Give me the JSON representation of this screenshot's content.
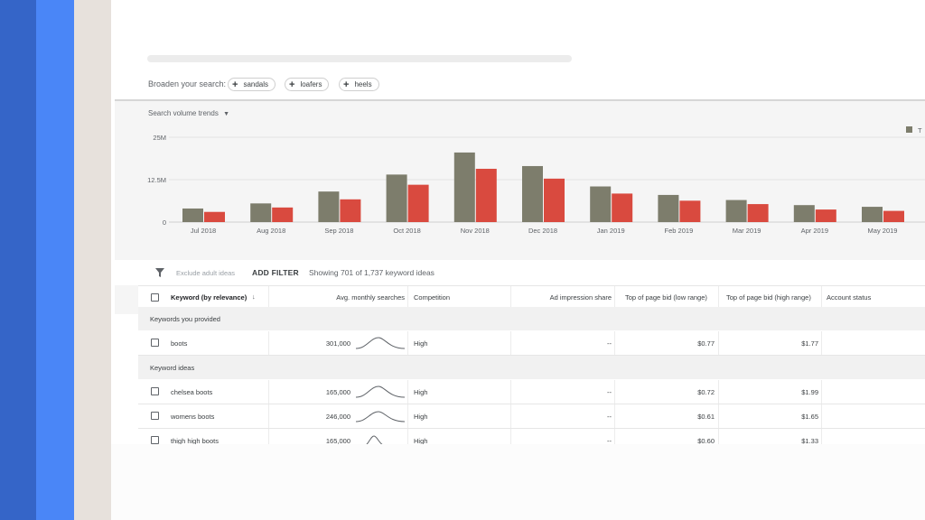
{
  "colors": {
    "stripe_dark": "#3565c8",
    "stripe_blue": "#4a86f7",
    "stripe_beige": "#e7e1dc",
    "bar_grey": "#7d7d6c",
    "bar_red": "#d94a3f"
  },
  "broaden": {
    "label": "Broaden your search:",
    "chips": [
      {
        "icon": "plus-icon",
        "label": "sandals"
      },
      {
        "icon": "plus-icon",
        "label": "loafers"
      },
      {
        "icon": "plus-icon",
        "label": "heels"
      }
    ]
  },
  "chart": {
    "dropdown_label": "Search volume trends",
    "legend_label": "T",
    "y_ticks": [
      "25M",
      "12.5M",
      "0"
    ]
  },
  "chart_data": {
    "type": "bar",
    "categories": [
      "Jul 2018",
      "Aug 2018",
      "Sep 2018",
      "Oct 2018",
      "Nov 2018",
      "Dec 2018",
      "Jan 2019",
      "Feb 2019",
      "Mar 2019",
      "Apr 2019",
      "May 2019"
    ],
    "series": [
      {
        "name": "T",
        "color": "#7d7d6c",
        "values": [
          4,
          5.5,
          9,
          14,
          20.5,
          16.5,
          10.5,
          8,
          6.5,
          5,
          4.5
        ]
      },
      {
        "color": "#d94a3f",
        "values": [
          3,
          4.3,
          6.7,
          11,
          15.7,
          12.8,
          8.4,
          6.3,
          5.3,
          3.7,
          3.3
        ]
      }
    ],
    "ylim": [
      0,
      25
    ],
    "ylabel": "",
    "xlabel": "",
    "grid": true,
    "legend": "top-right"
  },
  "filter": {
    "exclude_label": "Exclude adult ideas",
    "add_filter_label": "ADD FILTER",
    "showing_text": "Showing 701 of 1,737 keyword ideas"
  },
  "table": {
    "headers": [
      "Keyword (by relevance)",
      "Avg. monthly searches",
      "Competition",
      "Ad impression share",
      "Top of page bid (low range)",
      "Top of page bid (high range)",
      "Account status"
    ],
    "sections": [
      {
        "title": "Keywords you provided",
        "rows": [
          {
            "keyword": "boots",
            "searches": "301,000",
            "competition": "High",
            "share": "--",
            "low": "$0.77",
            "high": "$1.77",
            "status": ""
          }
        ]
      },
      {
        "title": "Keyword ideas",
        "rows": [
          {
            "keyword": "chelsea boots",
            "searches": "165,000",
            "competition": "High",
            "share": "--",
            "low": "$0.72",
            "high": "$1.99",
            "status": ""
          },
          {
            "keyword": "womens boots",
            "searches": "246,000",
            "competition": "High",
            "share": "--",
            "low": "$0.61",
            "high": "$1.65",
            "status": ""
          },
          {
            "keyword": "thigh high boots",
            "searches": "165,000",
            "competition": "High",
            "share": "--",
            "low": "$0.60",
            "high": "$1.33",
            "status": ""
          }
        ]
      }
    ]
  }
}
